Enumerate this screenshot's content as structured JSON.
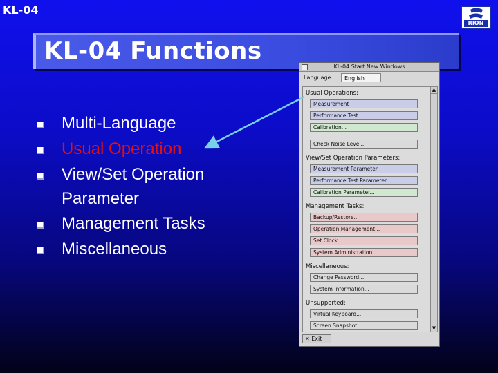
{
  "slide": {
    "corner_label": "KL-04",
    "title": "KL-04 Functions",
    "logo_text": "RION",
    "bullets": [
      {
        "label": "Multi-Language",
        "highlighted": false
      },
      {
        "label": "Usual Operation",
        "highlighted": true
      },
      {
        "label": "View/Set Operation",
        "continuation": "Parameter",
        "highlighted": false
      },
      {
        "label": "Management Tasks",
        "highlighted": false
      },
      {
        "label": "Miscellaneous",
        "highlighted": false
      }
    ],
    "colors": {
      "background_top": "#1010ee",
      "background_bottom": "#020218",
      "title_bar": "#3a4ce0",
      "highlight_text": "#e41010",
      "arrow": "#7ad0e8"
    }
  },
  "app_window": {
    "title": "KL-04   Start New Windows",
    "language_label": "Language:",
    "language_value": "English",
    "sections": [
      {
        "heading": "Usual Operations:",
        "buttons": [
          {
            "label": "Measurement",
            "color": "blue"
          },
          {
            "label": "Performance Test",
            "color": "blue"
          },
          {
            "label": "Calibration...",
            "color": "green"
          },
          {
            "label": "Check Noise Level...",
            "color": "gray"
          }
        ]
      },
      {
        "heading": "View/Set Operation Parameters:",
        "buttons": [
          {
            "label": "Measurement Parameter",
            "color": "blue"
          },
          {
            "label": "Performance Test Parameter...",
            "color": "blue"
          },
          {
            "label": "Calibration Parameter...",
            "color": "green"
          }
        ]
      },
      {
        "heading": "Management Tasks:",
        "buttons": [
          {
            "label": "Backup/Restore...",
            "color": "pink"
          },
          {
            "label": "Operation Management...",
            "color": "pink"
          },
          {
            "label": "Set Clock...",
            "color": "pink"
          },
          {
            "label": "System Administration...",
            "color": "pink"
          }
        ]
      },
      {
        "heading": "Miscellaneous:",
        "buttons": [
          {
            "label": "Change Password...",
            "color": "gray"
          },
          {
            "label": "System Information...",
            "color": "gray"
          }
        ]
      },
      {
        "heading": "Unsupported:",
        "buttons": [
          {
            "label": "Virtual Keyboard...",
            "color": "gray"
          },
          {
            "label": "Screen Snapshot...",
            "color": "gray"
          }
        ]
      }
    ],
    "exit_label": "Exit"
  }
}
